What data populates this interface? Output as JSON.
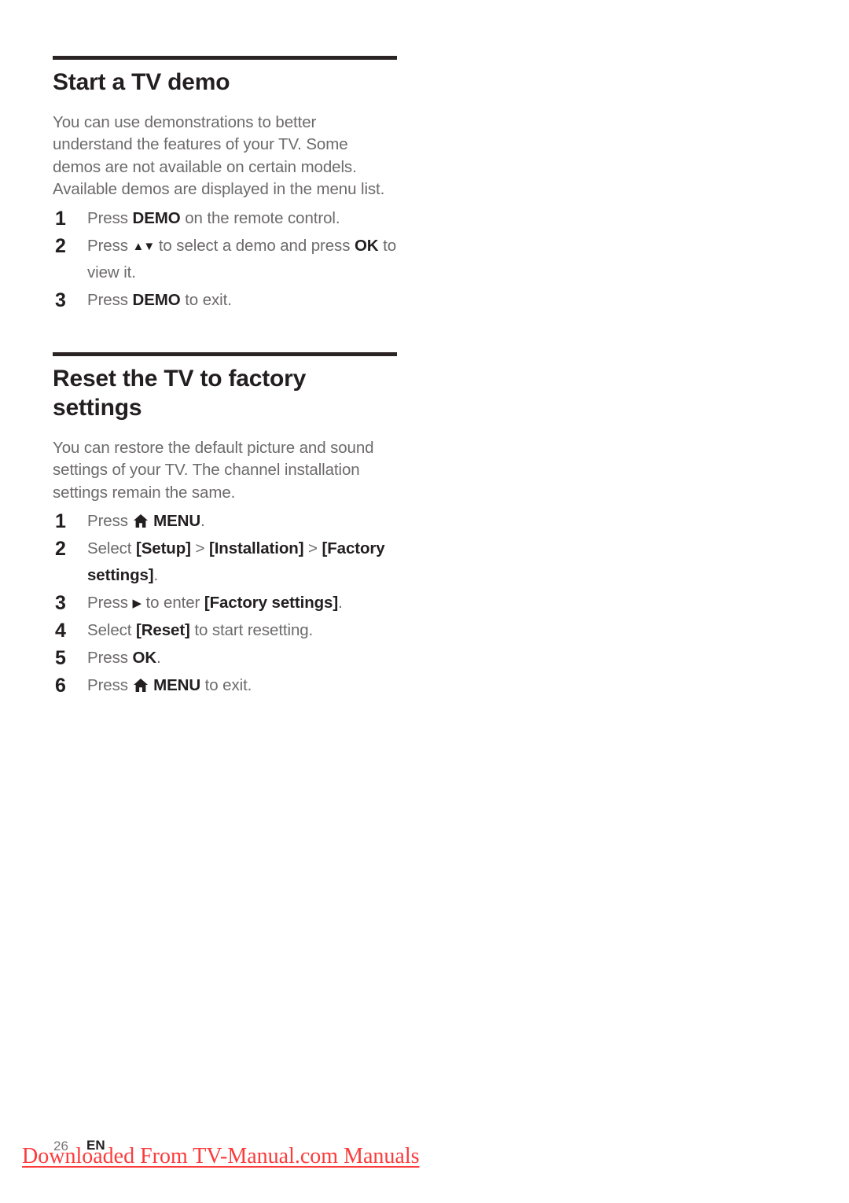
{
  "document": {
    "sections": [
      {
        "id": "start-tv-demo",
        "heading": "Start a TV demo",
        "intro": "You can use demonstrations to better understand the features of your TV. Some demos are not available on certain models. Available demos are displayed in the menu list.",
        "steps": [
          {
            "num": "1",
            "parts": [
              {
                "t": "text",
                "v": "Press "
              },
              {
                "t": "bold",
                "v": "DEMO"
              },
              {
                "t": "text",
                "v": " on the remote control."
              }
            ]
          },
          {
            "num": "2",
            "parts": [
              {
                "t": "text",
                "v": "Press "
              },
              {
                "t": "icon",
                "v": "triangle-up-down-icon"
              },
              {
                "t": "text",
                "v": " to select a demo and press "
              },
              {
                "t": "bold",
                "v": "OK"
              },
              {
                "t": "text",
                "v": " to view it."
              }
            ]
          },
          {
            "num": "3",
            "parts": [
              {
                "t": "text",
                "v": "Press "
              },
              {
                "t": "bold",
                "v": "DEMO"
              },
              {
                "t": "text",
                "v": " to exit."
              }
            ]
          }
        ]
      },
      {
        "id": "reset-tv-factory-settings",
        "heading": "Reset the TV to factory settings",
        "intro": "You can restore the default picture and sound settings of your TV. The channel installation settings remain the same.",
        "steps": [
          {
            "num": "1",
            "parts": [
              {
                "t": "text",
                "v": "Press "
              },
              {
                "t": "icon",
                "v": "home-icon"
              },
              {
                "t": "bold",
                "v": "MENU"
              },
              {
                "t": "text",
                "v": "."
              }
            ]
          },
          {
            "num": "2",
            "parts": [
              {
                "t": "text",
                "v": "Select "
              },
              {
                "t": "bold",
                "v": "[Setup]"
              },
              {
                "t": "text",
                "v": " > "
              },
              {
                "t": "bold",
                "v": "[Installation]"
              },
              {
                "t": "text",
                "v": " > "
              },
              {
                "t": "bold",
                "v": "[Factory settings]"
              },
              {
                "t": "text",
                "v": "."
              }
            ]
          },
          {
            "num": "3",
            "parts": [
              {
                "t": "text",
                "v": "Press "
              },
              {
                "t": "icon",
                "v": "triangle-right-icon"
              },
              {
                "t": "text",
                "v": " to enter "
              },
              {
                "t": "bold",
                "v": "[Factory settings]"
              },
              {
                "t": "text",
                "v": "."
              }
            ]
          },
          {
            "num": "4",
            "parts": [
              {
                "t": "text",
                "v": "Select "
              },
              {
                "t": "bold",
                "v": "[Reset]"
              },
              {
                "t": "text",
                "v": " to start resetting."
              }
            ]
          },
          {
            "num": "5",
            "parts": [
              {
                "t": "text",
                "v": "Press "
              },
              {
                "t": "bold",
                "v": "OK"
              },
              {
                "t": "text",
                "v": "."
              }
            ]
          },
          {
            "num": "6",
            "parts": [
              {
                "t": "text",
                "v": "Press "
              },
              {
                "t": "icon",
                "v": "home-icon"
              },
              {
                "t": "bold",
                "v": "MENU"
              },
              {
                "t": "text",
                "v": " to exit."
              }
            ]
          }
        ]
      }
    ]
  },
  "footer": {
    "page_number": "26",
    "language": "EN",
    "watermark": "Downloaded From TV-Manual.com Manuals"
  },
  "colors": {
    "heading": "#231f20",
    "body": "#6d6a6b",
    "rule": "#2b2424",
    "watermark": "#fc3b3b",
    "page_background": "#ffffff"
  },
  "icons": {
    "home-icon": "⌂",
    "triangle-up-down-icon": "▲▼",
    "triangle-right-icon": "▶"
  }
}
